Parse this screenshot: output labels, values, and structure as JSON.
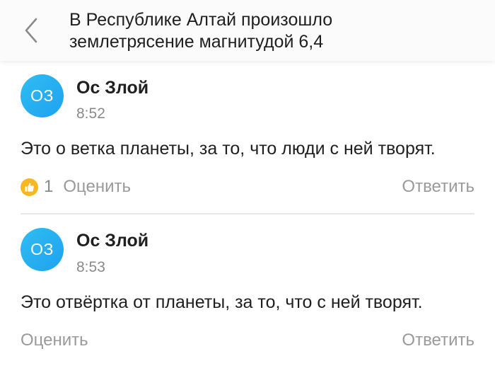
{
  "header": {
    "back_icon": "chevron-left-icon",
    "title_line1": "В Республике Алтай произошло",
    "title_line2": "землетрясение магнитудой 6,4"
  },
  "comments": [
    {
      "avatar_initials": "ОЗ",
      "author": "Ос Злой",
      "time": "8:52",
      "text": "Это о ветка планеты, за то, что люди с ней творят.",
      "like_icon": "thumbs-up-icon",
      "like_count": "1",
      "rate_label": "Оценить",
      "reply_label": "Ответить"
    },
    {
      "avatar_initials": "ОЗ",
      "author": "Ос Злой",
      "time": "8:53",
      "text": "Это отвёртка от планеты, за то, что с ней творят.",
      "rate_label": "Оценить",
      "reply_label": "Ответить"
    }
  ],
  "colors": {
    "avatar": "#1ea2ef",
    "like_badge": "#f6b81e",
    "muted_text": "#9a9a9a"
  }
}
